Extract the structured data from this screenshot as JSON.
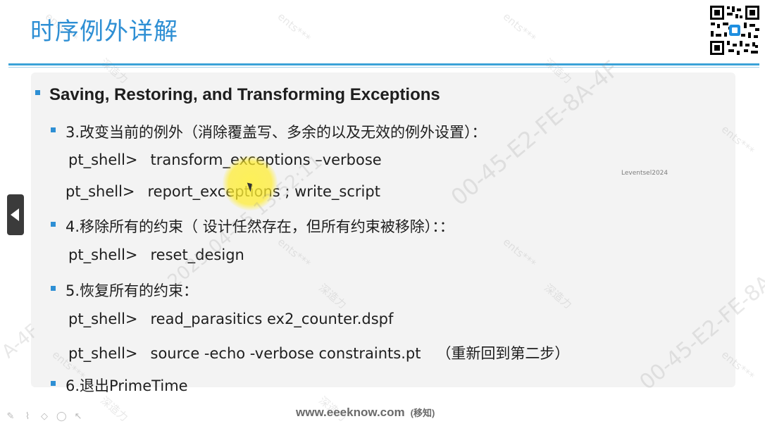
{
  "slide": {
    "title": "时序例外详解",
    "heading": "Saving, Restoring, and Transforming Exceptions",
    "items": [
      {
        "text": "3.改变当前的例外（消除覆盖写、多余的以及无效的例外设置）："
      },
      {
        "text": "4.移除所有的约束（ 设计任然存在，但所有约束被移除）：："
      },
      {
        "text": "5.恢复所有的约束："
      },
      {
        "text": "6.退出PrimeTime"
      }
    ],
    "commands": [
      {
        "prompt": "pt_shell>",
        "cmd": "transform_exceptions –verbose"
      },
      {
        "prompt": "pt_shell>",
        "cmd": "report_exceptions ; write_script"
      },
      {
        "prompt": "pt_shell>",
        "cmd": "reset_design"
      },
      {
        "prompt": "pt_shell>",
        "cmd": "read_parasitics ex2_counter.dspf"
      },
      {
        "prompt": "pt_shell>",
        "cmd": "source -echo -verbose constraints.pt",
        "note": "（重新回到第二步）"
      }
    ],
    "small_tag": "Leventsel2024"
  },
  "footer": {
    "url": "www.eeeknow.com",
    "suffix": "(移知)"
  },
  "watermark": {
    "code": "00-45-E2-FE-8A-4F",
    "date": "2025-04-15 13:52:11",
    "label_a": "ents***",
    "label_b": "深造力",
    "partial": "A-4F"
  },
  "colors": {
    "title": "#2e8fd4",
    "bullet": "#2e8fd4",
    "rule": "#3aa2d8"
  },
  "icons": [
    "left-arrow-icon",
    "pen-icon",
    "highlighter-icon",
    "eraser-icon",
    "lasso-icon",
    "pointer-icon",
    "qr-code-icon",
    "mouse-cursor-icon"
  ]
}
